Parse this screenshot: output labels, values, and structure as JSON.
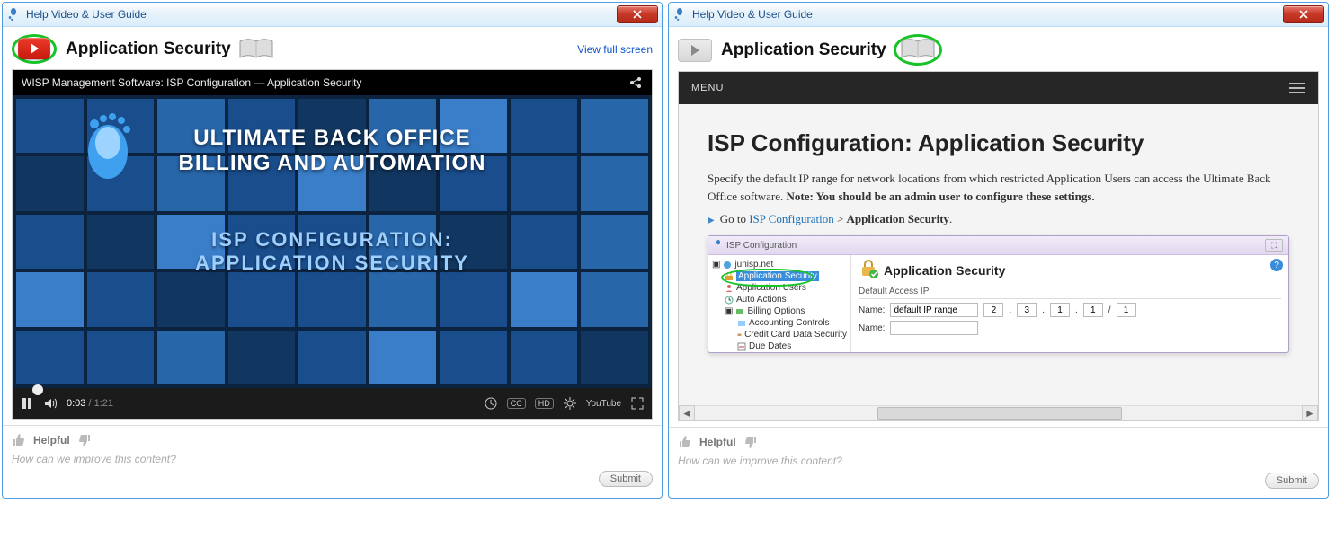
{
  "left": {
    "window_title": "Help Video & User Guide",
    "page_title": "Application Security",
    "view_full_screen": "View full screen",
    "video": {
      "top_title": "WISP Management Software: ISP Configuration — Application Security",
      "headline1": "ULTIMATE BACK OFFICE",
      "headline2": "BILLING AND AUTOMATION",
      "sub1": "ISP CONFIGURATION:",
      "sub2": "APPLICATION SECURITY",
      "time_current": "0:03",
      "time_duration": "1:21",
      "cc_label": "CC",
      "hd_label": "HD",
      "youtube_label": "YouTube"
    },
    "feedback": {
      "helpful_label": "Helpful",
      "placeholder": "How can we improve this content?",
      "submit_label": "Submit"
    }
  },
  "right": {
    "window_title": "Help Video & User Guide",
    "page_title": "Application Security",
    "menu_label": "MENU",
    "guide": {
      "heading": "ISP Configuration: Application Security",
      "para_pre": "Specify the default IP range for network locations from which restricted Application Users can access the Ultimate Back Office software. ",
      "note_label": "Note: You should be an admin user to configure these settings.",
      "goto_prefix": "Go to ",
      "goto_link": "ISP Configuration",
      "goto_sep": " > ",
      "goto_bold": "Application Security",
      "goto_suffix": "."
    },
    "mini": {
      "title": "ISP Configuration",
      "tree": {
        "root": "junisp.net",
        "app_security": "Application Security",
        "app_users": "Application Users",
        "auto_actions": "Auto Actions",
        "billing_options": "Billing Options",
        "accounting_controls": "Accounting Controls",
        "cc_security": "Credit Card Data Security",
        "due_dates": "Due Dates"
      },
      "cfg": {
        "title": "Application Security",
        "section": "Default Access IP",
        "name_label": "Name:",
        "name_value": "default IP range",
        "ip1": "2",
        "ip2": "3",
        "ip3": "1",
        "ip4": "1",
        "mask_sep": "/",
        "mask": "1",
        "name2_label": "Name:"
      }
    },
    "feedback": {
      "helpful_label": "Helpful",
      "placeholder": "How can we improve this content?",
      "submit_label": "Submit"
    }
  }
}
